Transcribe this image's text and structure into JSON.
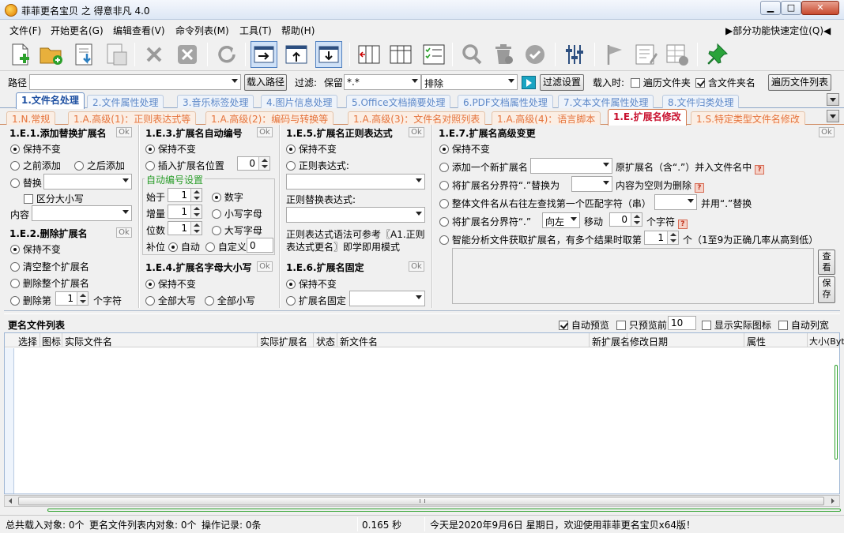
{
  "window": {
    "title": "菲菲更名宝贝 之 得意非凡 4.0",
    "min_glyph": "▁",
    "max_glyph": "□",
    "close_glyph": "✕"
  },
  "menu": {
    "items": [
      "文件(F)",
      "开始更名(G)",
      "编辑查看(V)",
      "命令列表(M)",
      "工具(T)",
      "帮助(H)"
    ],
    "right": "▶部分功能快速定位(Q)◀"
  },
  "pathrow": {
    "path_label": "路径",
    "load_path_btn": "载入路径",
    "filter_label": "过滤:",
    "keep_label": "保留",
    "keep_value": "*.*",
    "exclude_label": "排除",
    "filter_settings_btn": "过滤设置",
    "load_time_label": "载入时:",
    "traverse_folder_label": "遍历文件夹",
    "include_folder_label": "含文件夹名",
    "traverse_list_btn": "遍历文件列表"
  },
  "tabs_main": [
    "1.文件名处理",
    "2.文件属性处理",
    "3.音乐标签处理",
    "4.图片信息处理",
    "5.Office文档摘要处理",
    "6.PDF文档属性处理",
    "7.文本文件属性处理",
    "8.文件归类处理"
  ],
  "tabs_sub": [
    "1.N.常规",
    "1.A.高级(1)：正则表达式等",
    "1.A.高级(2)：编码与转换等",
    "1.A.高级(3)：文件名对照列表",
    "1.A.高级(4)：语言脚本",
    "1.E.扩展名修改",
    "1.S.特定类型文件名修改"
  ],
  "ok_label": "Ok",
  "p1": {
    "title": "1.E.1.添加替换扩展名",
    "keep": "保持不变",
    "before": "之前添加",
    "after": "之后添加",
    "replace": "替换",
    "case": "区分大小写",
    "content": "内容"
  },
  "p2": {
    "title": "1.E.2.删除扩展名",
    "keep": "保持不变",
    "clear": "清空整个扩展名",
    "delete": "删除整个扩展名",
    "delete_n_pre": "删除第",
    "delete_n_val": "1",
    "delete_n_post": "个字符"
  },
  "p3": {
    "title": "1.E.3.扩展名自动编号",
    "keep": "保持不变",
    "insert": "插入扩展名位置",
    "insert_val": "0",
    "group_title": "自动编号设置",
    "start_label": "始于",
    "start_val": "1",
    "inc_label": "增量",
    "inc_val": "1",
    "digits_label": "位数",
    "digits_val": "1",
    "num": "数字",
    "lower": "小写字母",
    "upper": "大写字母",
    "pad_label": "补位",
    "auto": "自动",
    "custom": "自定义",
    "custom_val": "0"
  },
  "p4": {
    "title": "1.E.4.扩展名字母大小写",
    "keep": "保持不变",
    "all_upper": "全部大写",
    "all_lower": "全部小写"
  },
  "p5": {
    "title": "1.E.5.扩展名正则表达式",
    "keep": "保持不变",
    "regex": "正则表达式:",
    "regex_replace": "正则替换表达式:",
    "hint": "正则表达式语法可参考〖A1.正则表达式更名〗即学即用模式"
  },
  "p6": {
    "title": "1.E.6.扩展名固定",
    "keep": "保持不变",
    "fixed": "扩展名固定"
  },
  "p7": {
    "title": "1.E.7.扩展名高级变更",
    "keep": "保持不变",
    "add_new": "添加一个新扩展名",
    "add_new_tail": "原扩展名（含“.”）并入文件名中",
    "sep_replace_pre": "将扩展名分界符“.”替换为",
    "sep_replace_tail": "内容为空则为删除",
    "search": "整体文件名从右往左查找第一个匹配字符（串）",
    "search_tail": "并用“.”替换",
    "move_pre": "将扩展名分界符“.”",
    "move_dir": "向左",
    "move_label": "移动",
    "move_val": "0",
    "move_unit": "个字符",
    "smart": "智能分析文件获取扩展名，有多个结果时取第",
    "smart_val": "1",
    "smart_tail": "个（1至9为正确几率从高到低）",
    "view_btn": "查看",
    "save_btn": "保存",
    "help": "?"
  },
  "list": {
    "title": "更名文件列表",
    "auto_preview": "自动预览",
    "preview_first": "只预览前",
    "preview_n": "10",
    "show_icon": "显示实际图标",
    "auto_width": "自动列宽",
    "columns": [
      "选择",
      "图标",
      "实际文件名",
      "实际扩展名",
      "状态",
      "新文件名",
      "新扩展名",
      "修改日期",
      "属性",
      "大小(Bytes)"
    ]
  },
  "status": {
    "total": "总共载入对象: 0个",
    "inlist": "更名文件列表内对象: 0个",
    "ops": "操作记录: 0条",
    "time": "0.165 秒",
    "welcome": "今天是2020年9月6日  星期日，欢迎使用菲菲更名宝贝x64版！"
  }
}
